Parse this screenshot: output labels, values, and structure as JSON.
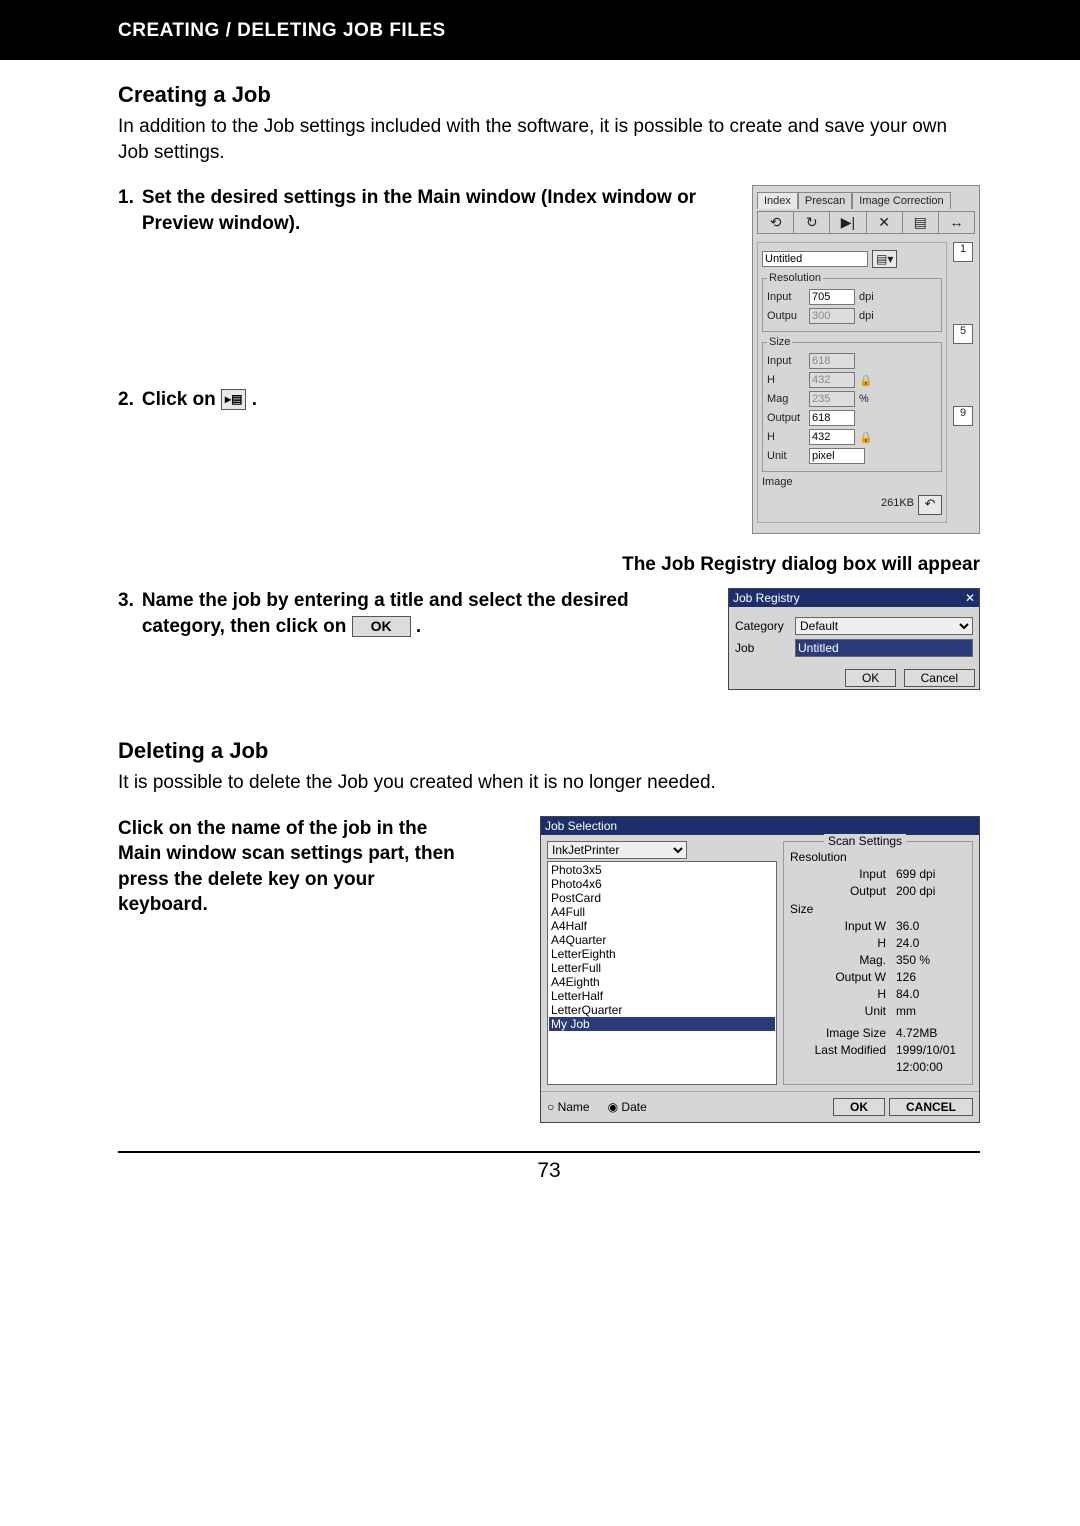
{
  "header": {
    "title": "CREATING / DELETING JOB FILES"
  },
  "creating": {
    "heading": "Creating a Job",
    "intro": "In addition to the Job settings included with the software, it is possible to create and save your own Job settings.",
    "step1_num": "1.",
    "step1": "Set the desired settings in the Main window (Index window or Preview window).",
    "step2_num": "2.",
    "step2_pre": "Click on",
    "step2_post": ".",
    "registry_caption": "The Job Registry dialog box will appear",
    "step3_num": "3.",
    "step3_a": "Name the job by entering a title and select the desired category, then click on",
    "step3_b": "."
  },
  "panel1": {
    "tabs": [
      "Index",
      "Prescan",
      "Image Correction"
    ],
    "job_name": "Untitled",
    "resolution_legend": "Resolution",
    "input_label": "Input",
    "input_value": "705",
    "input_unit": "dpi",
    "output_label": "Outpu",
    "output_value": "300",
    "output_unit": "dpi",
    "size_legend": "Size",
    "size_input_label": "Input",
    "size_input_value": "618",
    "size_h1_label": "H",
    "size_h1_value": "432",
    "mag_label": "Mag",
    "mag_value": "235",
    "mag_unit": "%",
    "size_output_label": "Output",
    "size_output_value": "618",
    "size_h2_label": "H",
    "size_h2_value": "432",
    "unit_label": "Unit",
    "unit_value": "pixel",
    "image_label": "Image",
    "image_size": "261KB",
    "side_numbers": [
      "1",
      "5",
      "9"
    ]
  },
  "registry": {
    "title": "Job Registry",
    "category_label": "Category",
    "category_value": "Default",
    "job_label": "Job",
    "job_value": "Untitled",
    "ok": "OK",
    "cancel": "Cancel"
  },
  "ok_chip": "OK",
  "deleting": {
    "heading": "Deleting a Job",
    "intro": "It is possible to delete the Job you created when it is no longer needed.",
    "instruction": "Click on the name of the job in the Main window scan settings part, then press the delete key on your keyboard."
  },
  "jobsel": {
    "title": "Job Selection",
    "combo": "InkJetPrinter",
    "list": [
      "Photo3x5",
      "Photo4x6",
      "PostCard",
      "A4Full",
      "A4Half",
      "A4Quarter",
      "LetterEighth",
      "LetterFull",
      "A4Eighth",
      "LetterHalf",
      "LetterQuarter",
      "My Job"
    ],
    "selected_index": 11,
    "scan_heading": "Scan Settings",
    "res_label": "Resolution",
    "res_input_k": "Input",
    "res_input_v": "699 dpi",
    "res_output_k": "Output",
    "res_output_v": "200 dpi",
    "size_label": "Size",
    "sz_iw_k": "Input   W",
    "sz_iw_v": "36.0",
    "sz_ih_k": "H",
    "sz_ih_v": "24.0",
    "sz_mag_k": "Mag.",
    "sz_mag_v": "350 %",
    "sz_ow_k": "Output  W",
    "sz_ow_v": "126",
    "sz_oh_k": "H",
    "sz_oh_v": "84.0",
    "sz_unit_k": "Unit",
    "sz_unit_v": "mm",
    "img_k": "Image Size",
    "img_v": "4.72MB",
    "lm_k": "Last Modified",
    "lm_v1": "1999/10/01",
    "lm_v2": "12:00:00",
    "radio_name": "Name",
    "radio_date": "Date",
    "ok": "OK",
    "cancel": "CANCEL"
  },
  "page_number": "73"
}
